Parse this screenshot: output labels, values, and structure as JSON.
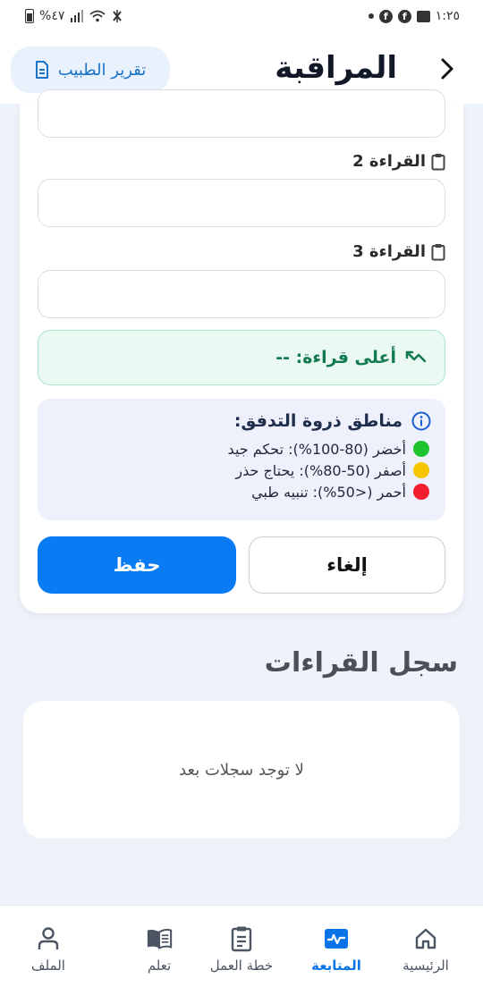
{
  "status_bar": {
    "time": "١:٢٥",
    "battery": "%٤٧"
  },
  "header": {
    "title": "المراقبة",
    "doctor_report_label": "تقرير الطبيب"
  },
  "form": {
    "reading2_label": "القراءة 2",
    "reading2_value": "",
    "reading3_label": "القراءة 3",
    "reading3_value": "",
    "peak_reading": "أعلى قراءة: --",
    "zones": {
      "title": "مناطق ذروة التدفق:",
      "items": [
        {
          "text": "أخضر (80-100%): تحكم جيد",
          "color": "#1ec42e"
        },
        {
          "text": "أصفر (50-80%): يحتاج حذر",
          "color": "#f7c400"
        },
        {
          "text": "أحمر (<50%): تنبيه طبي",
          "color": "#f21d2f"
        }
      ]
    },
    "cancel_label": "إلغاء",
    "save_label": "حفظ"
  },
  "history": {
    "title": "سجل القراءات",
    "empty_message": "لا توجد سجلات بعد"
  },
  "bottom_nav": {
    "items": [
      {
        "label": "الرئيسية",
        "icon": "home-icon"
      },
      {
        "label": "المتابعة",
        "icon": "pulse-icon",
        "active": true
      },
      {
        "label": "خطة العمل",
        "icon": "clipboard-icon"
      },
      {
        "label": "تعلم",
        "icon": "book-icon"
      },
      {
        "label": "الملف",
        "icon": "user-icon"
      }
    ]
  },
  "colors": {
    "primary": "#0a7cf3",
    "peak_bg": "#eafaf3",
    "peak_text": "#127a52"
  }
}
